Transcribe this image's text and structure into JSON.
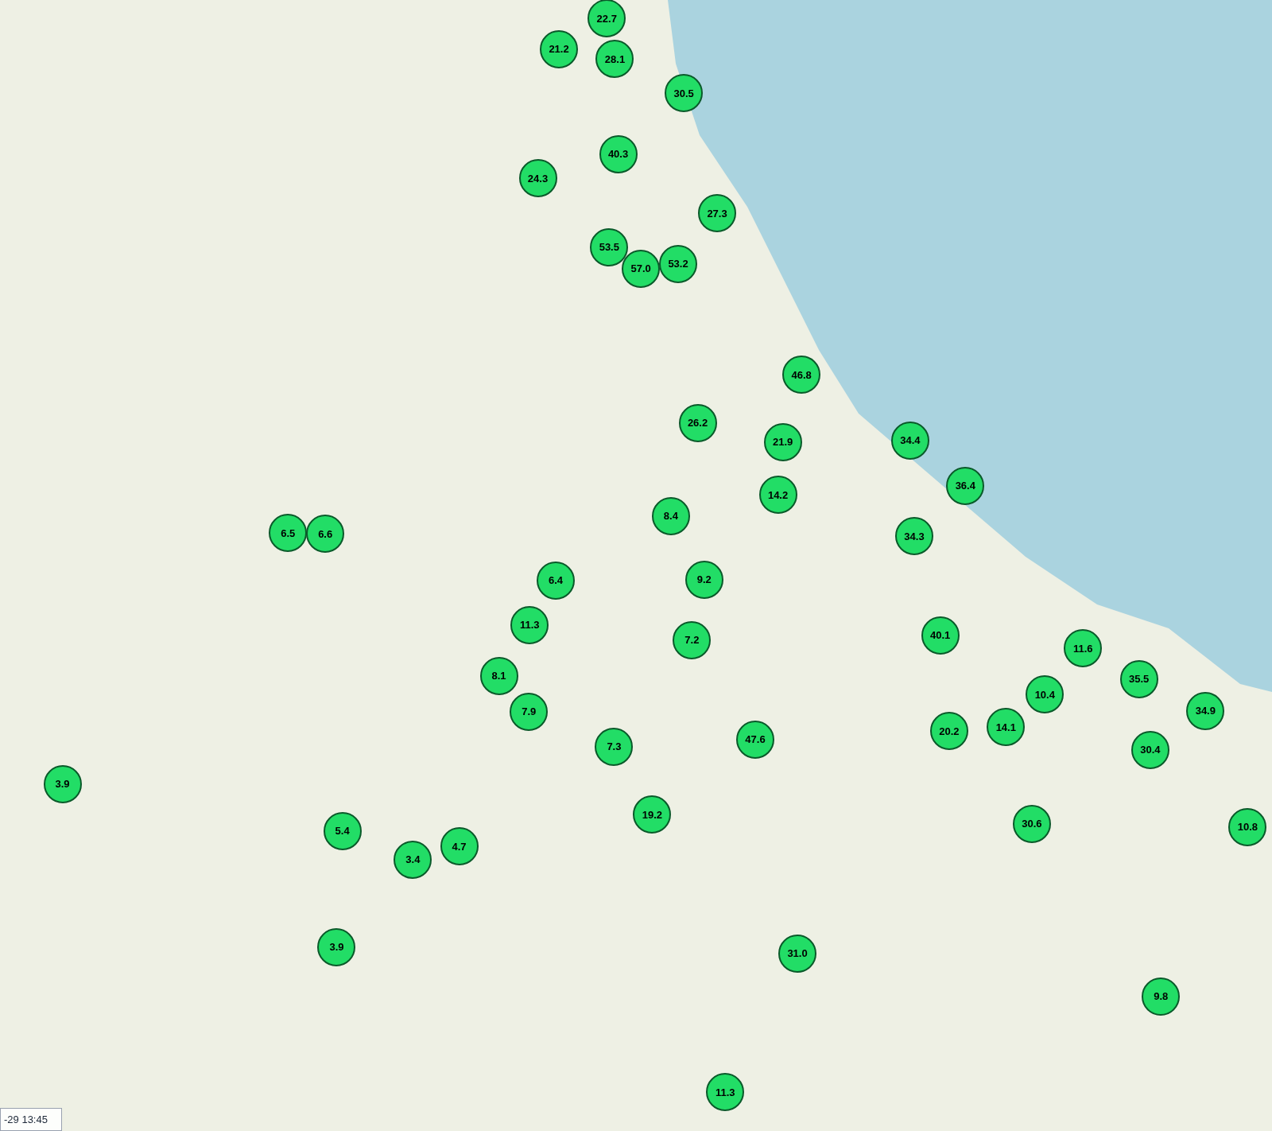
{
  "map": {
    "markers": [
      {
        "value": "22.7"
      },
      {
        "value": "21.2"
      },
      {
        "value": "28.1"
      },
      {
        "value": "30.5"
      },
      {
        "value": "40.3"
      },
      {
        "value": "24.3"
      },
      {
        "value": "27.3"
      },
      {
        "value": "53.5"
      },
      {
        "value": "53.2"
      },
      {
        "value": "57.0"
      },
      {
        "value": "46.8"
      },
      {
        "value": "26.2"
      },
      {
        "value": "34.4"
      },
      {
        "value": "21.9"
      },
      {
        "value": "36.4"
      },
      {
        "value": "14.2"
      },
      {
        "value": "8.4"
      },
      {
        "value": "6.5"
      },
      {
        "value": "6.6"
      },
      {
        "value": "34.3"
      },
      {
        "value": "9.2"
      },
      {
        "value": "6.4"
      },
      {
        "value": "11.3"
      },
      {
        "value": "40.1"
      },
      {
        "value": "7.2"
      },
      {
        "value": "11.6"
      },
      {
        "value": "8.1"
      },
      {
        "value": "35.5"
      },
      {
        "value": "10.4"
      },
      {
        "value": "34.9"
      },
      {
        "value": "7.9"
      },
      {
        "value": "14.1"
      },
      {
        "value": "20.2"
      },
      {
        "value": "47.6"
      },
      {
        "value": "7.3"
      },
      {
        "value": "30.4"
      },
      {
        "value": "3.9"
      },
      {
        "value": "19.2"
      },
      {
        "value": "30.6"
      },
      {
        "value": "10.8"
      },
      {
        "value": "5.4"
      },
      {
        "value": "4.7"
      },
      {
        "value": "3.4"
      },
      {
        "value": "3.9"
      },
      {
        "value": "31.0"
      },
      {
        "value": "9.8"
      },
      {
        "value": "11.3"
      }
    ]
  },
  "timestamp": "-29 13:45"
}
